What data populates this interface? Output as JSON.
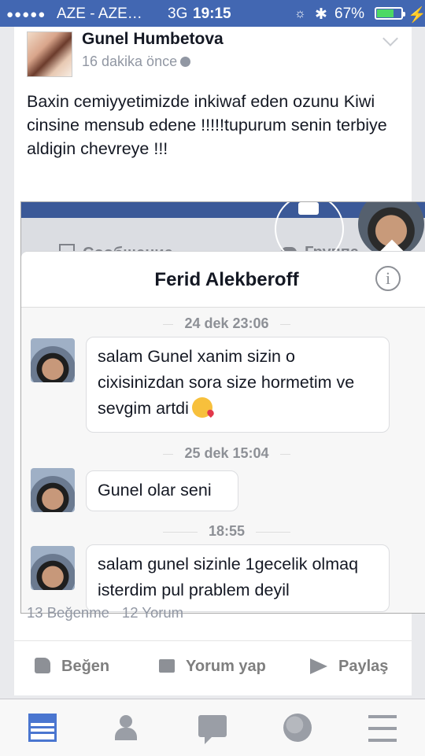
{
  "status_bar": {
    "signal": "●●●●●",
    "carrier": "AZE - AZE…",
    "network": "3G",
    "time": "19:15",
    "bluetooth": "✱",
    "battery_percent": "67%",
    "battery_level": 0.67,
    "charging": "⚡"
  },
  "post": {
    "author": "Gunel Humbetova",
    "time": "16 dakika önce",
    "text": "Baxin cemiyyetimizde inkiwaf eden ozunu Kiwi cinsine mensub edene !!!!!tupurum senin terbiye aldigin chevreye !!!",
    "screenshot": {
      "bg_button_message": "Сообщение",
      "bg_button_group": "Группа",
      "chat_name": "Ferid Alekberoff",
      "info_icon": "i",
      "messages": [
        {
          "timestamp": "24 dek 23:06",
          "text": "salam Gunel xanim sizin o cixisinizdan sora size hormetim ve sevgim artdi",
          "emoji": "kissing-heart-emoji"
        },
        {
          "timestamp": "25 dek 15:04",
          "text": "Gunel olar seni"
        },
        {
          "timestamp": "18:55",
          "text": "salam gunel sizinle 1gecelik olmaq isterdim pul prablem deyil"
        }
      ]
    },
    "likes": "13 Beğenme",
    "comments": "12 Yorum",
    "actions": {
      "like": "Beğen",
      "comment": "Yorum yap",
      "share": "Paylaş"
    }
  },
  "tab_bar": {
    "tabs": [
      "news-feed-icon",
      "friends-icon",
      "messages-icon",
      "notifications-globe-icon",
      "menu-icon"
    ],
    "active": "news-feed-icon"
  },
  "colors": {
    "brand": "#4267b2",
    "active_tab": "#4a76d0",
    "text": "#141823",
    "muted": "#9197a3"
  }
}
